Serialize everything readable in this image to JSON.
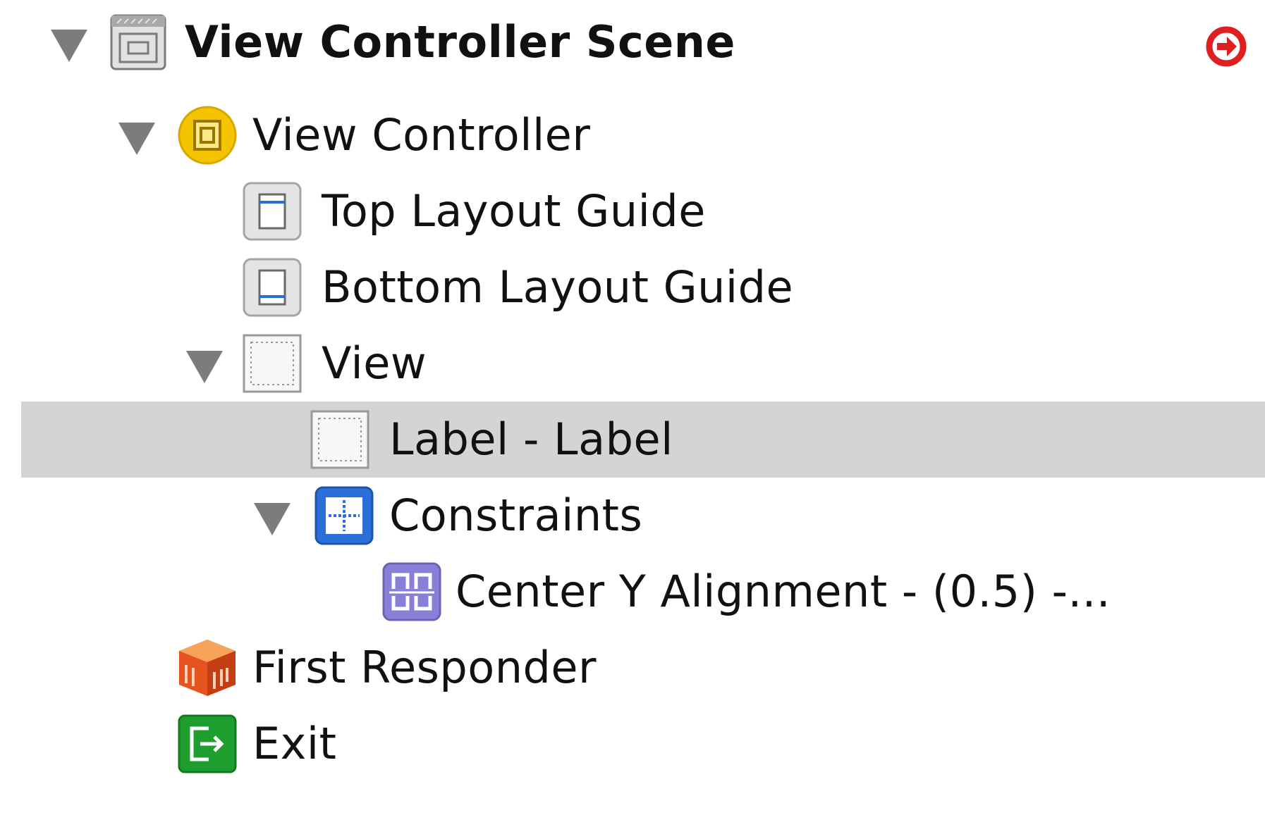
{
  "outline": {
    "scene": {
      "label": "View Controller Scene",
      "icon": "scene-icon",
      "warning_icon": "warning-arrow-icon",
      "warning_color": "#e02020"
    },
    "view_controller": {
      "label": "View Controller",
      "icon": "view-controller-icon",
      "icon_color": "#f5c400"
    },
    "top_layout_guide": {
      "label": "Top Layout Guide",
      "icon": "top-layout-guide-icon"
    },
    "bottom_layout_guide": {
      "label": "Bottom Layout Guide",
      "icon": "bottom-layout-guide-icon"
    },
    "view": {
      "label": "View",
      "icon": "view-icon"
    },
    "label_item": {
      "label": "Label - Label",
      "icon": "label-icon",
      "selected": true,
      "selection_color": "#d4d4d4"
    },
    "constraints": {
      "label": "Constraints",
      "icon": "constraints-icon",
      "icon_color": "#2b6fd8"
    },
    "center_y": {
      "label": "Center Y Alignment - (0.5) -...",
      "icon": "alignment-constraint-icon",
      "icon_color": "#8a7fd6"
    },
    "first_responder": {
      "label": "First Responder",
      "icon": "first-responder-cube-icon",
      "icon_color": "#e5541f"
    },
    "exit": {
      "label": "Exit",
      "icon": "exit-icon",
      "icon_color": "#1e9e2e"
    }
  }
}
